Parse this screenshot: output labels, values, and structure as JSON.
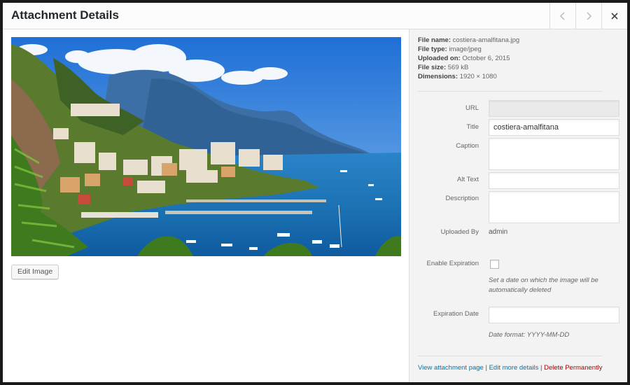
{
  "header": {
    "title": "Attachment Details"
  },
  "image": {
    "description": "Coastal town on a hillside beside a blue bay with boats",
    "edit_label": "Edit Image"
  },
  "file_info": [
    {
      "label": "File name:",
      "value": "costiera-amalfitana.jpg"
    },
    {
      "label": "File type:",
      "value": "image/jpeg"
    },
    {
      "label": "Uploaded on:",
      "value": "October 6, 2015"
    },
    {
      "label": "File size:",
      "value": "569 kB"
    },
    {
      "label": "Dimensions:",
      "value": "1920 × 1080"
    }
  ],
  "fields": {
    "url": {
      "label": "URL",
      "value": ""
    },
    "title": {
      "label": "Title",
      "value": "costiera-amalfitana"
    },
    "caption": {
      "label": "Caption",
      "value": ""
    },
    "alt_text": {
      "label": "Alt Text",
      "value": ""
    },
    "description": {
      "label": "Description",
      "value": ""
    },
    "uploaded_by": {
      "label": "Uploaded By",
      "value": "admin"
    },
    "enable_expiration": {
      "label": "Enable Expiration",
      "checked": false,
      "hint": "Set a date on which the image will be automatically deleted"
    },
    "expiration_date": {
      "label": "Expiration Date",
      "value": "",
      "hint": "Date format: YYYY-MM-DD"
    }
  },
  "actions": {
    "view": "View attachment page",
    "edit_more": "Edit more details",
    "delete": "Delete Permanently",
    "separator": "|"
  },
  "colors": {
    "link": "#0073aa",
    "delete": "#aa0000",
    "sidebar_bg": "#f3f3f3"
  }
}
